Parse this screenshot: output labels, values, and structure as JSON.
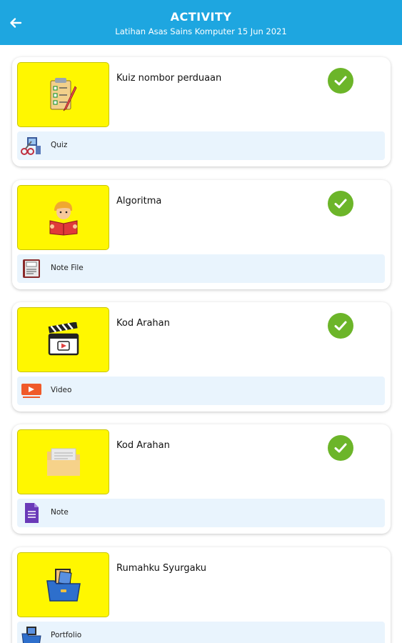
{
  "header": {
    "title": "ACTIVITY",
    "subtitle": "Latihan Asas Sains Komputer 15 Jun 2021",
    "color": "#1ea6e0"
  },
  "activities": [
    {
      "title": "Kuiz nombor perduaan",
      "type": "Quiz",
      "thumb_icon": "checklist-icon",
      "type_icon": "quiz-tools-icon",
      "completed": true
    },
    {
      "title": "Algoritma",
      "type": "Note File",
      "thumb_icon": "boy-reading-icon",
      "type_icon": "note-file-icon",
      "completed": true
    },
    {
      "title": "Kod Arahan",
      "type": "Video",
      "thumb_icon": "clapperboard-icon",
      "type_icon": "video-icon",
      "completed": true
    },
    {
      "title": "Kod Arahan",
      "type": "Note",
      "thumb_icon": "folder-icon",
      "type_icon": "document-icon",
      "completed": true
    },
    {
      "title": "Rumahku Syurgaku",
      "type": "Portfolio",
      "thumb_icon": "portfolio-folder-icon",
      "type_icon": "portfolio-icon",
      "completed": false
    }
  ],
  "colors": {
    "thumb_bg": "#fff700",
    "check_green": "#6cb529",
    "type_bar_bg": "#e9f4fd"
  }
}
